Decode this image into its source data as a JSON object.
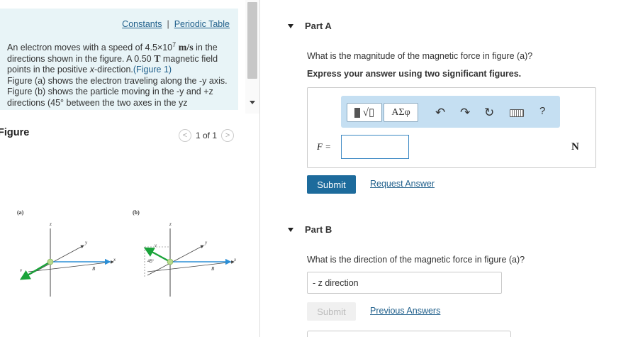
{
  "links": {
    "constants": "Constants",
    "separator": "|",
    "periodic_table": "Periodic Table"
  },
  "problem": {
    "p1": "An electron moves with a speed of 4.5×10",
    "p1_exp": "7",
    "p1_unit": "m/s",
    "p1_b": " in the directions shown in the figure. A 0.50 ",
    "p1_t": "T",
    "p1_c": " magnetic field points in the positive ",
    "p1_x": "x",
    "p1_d": "-direction.",
    "fig_link": "(Figure 1)",
    "p2": "Figure (a) shows the electron traveling along the -y axis. Figure (b) shows the particle moving in the -y and +z directions (45° between the two axes in the yz"
  },
  "figure": {
    "heading": "Figure",
    "pager_text": "1 of 1",
    "prev_glyph": "<",
    "next_glyph": ">",
    "label_a": "(a)",
    "label_b": "(b)",
    "axis_z": "z",
    "axis_y": "y",
    "axis_x": "x",
    "vec_v": "v",
    "vec_b": "B",
    "angle": "45°"
  },
  "partA": {
    "title": "Part A",
    "question": "What is the magnitude of the magnetic force in figure (a)?",
    "instruction": "Express your answer using two significant figures.",
    "greek_btn": "ΑΣφ",
    "help": "?",
    "var_label": "F =",
    "answer_value": "",
    "unit": "N",
    "submit": "Submit",
    "request": "Request Answer"
  },
  "partB": {
    "title": "Part B",
    "question": "What is the direction of the magnetic force in figure (a)?",
    "selected": "- z direction",
    "submit": "Submit",
    "previous": "Previous Answers"
  }
}
